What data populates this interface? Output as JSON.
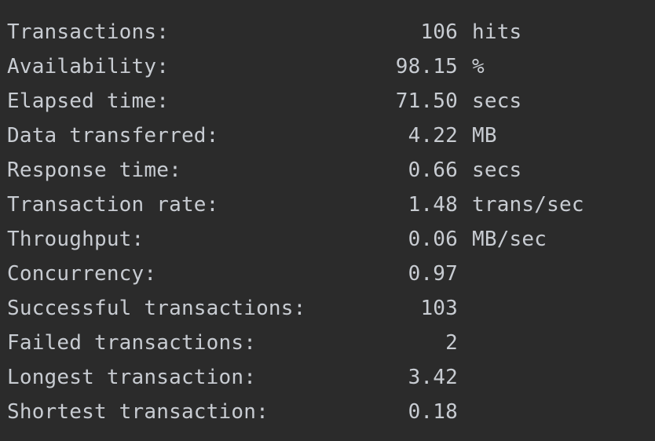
{
  "stats": [
    {
      "label": "Transactions:",
      "value": "106",
      "unit": "hits"
    },
    {
      "label": "Availability:",
      "value": "98.15",
      "unit": "%"
    },
    {
      "label": "Elapsed time:",
      "value": "71.50",
      "unit": "secs"
    },
    {
      "label": "Data transferred:",
      "value": "4.22",
      "unit": "MB"
    },
    {
      "label": "Response time:",
      "value": "0.66",
      "unit": "secs"
    },
    {
      "label": "Transaction rate:",
      "value": "1.48",
      "unit": "trans/sec"
    },
    {
      "label": "Throughput:",
      "value": "0.06",
      "unit": "MB/sec"
    },
    {
      "label": "Concurrency:",
      "value": "0.97",
      "unit": ""
    },
    {
      "label": "Successful transactions:",
      "value": "103",
      "unit": ""
    },
    {
      "label": "Failed transactions:",
      "value": "2",
      "unit": ""
    },
    {
      "label": "Longest transaction:",
      "value": "3.42",
      "unit": ""
    },
    {
      "label": "Shortest transaction:",
      "value": "0.18",
      "unit": ""
    }
  ],
  "colors": {
    "background": "#2b2b2b",
    "text": "#c8ccd2"
  }
}
